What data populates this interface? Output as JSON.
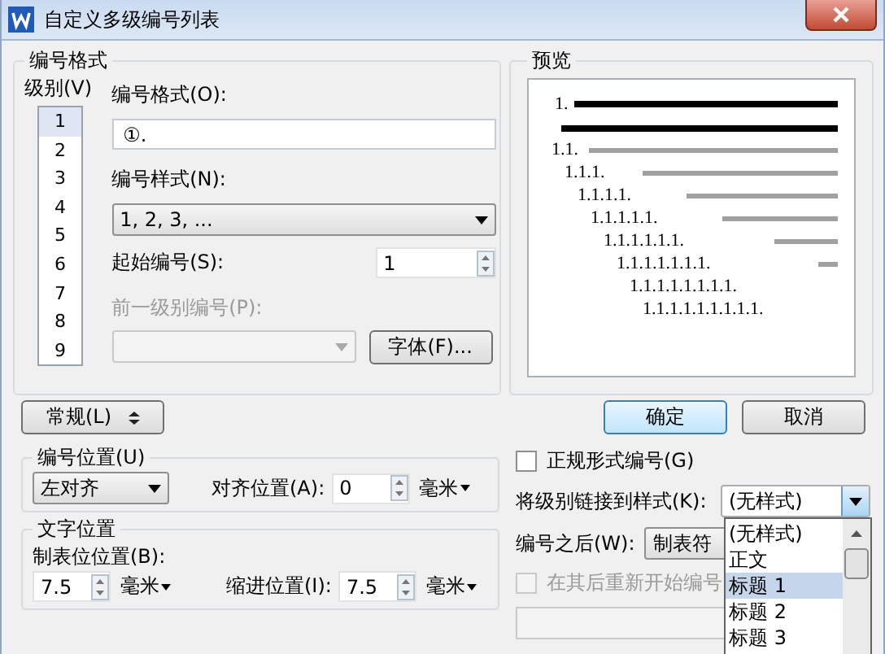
{
  "window": {
    "title": "自定义多级编号列表"
  },
  "number_format": {
    "legend": "编号格式",
    "level_label": "级别(V)",
    "levels": [
      {
        "label": "1",
        "selected": true
      },
      {
        "label": "2",
        "selected": false
      },
      {
        "label": "3",
        "selected": false
      },
      {
        "label": "4",
        "selected": false
      },
      {
        "label": "5",
        "selected": false
      },
      {
        "label": "6",
        "selected": false
      },
      {
        "label": "7",
        "selected": false
      },
      {
        "label": "8",
        "selected": false
      },
      {
        "label": "9",
        "selected": false
      }
    ],
    "format_label": "编号格式(O):",
    "format_value": "①.",
    "style_label": "编号样式(N):",
    "style_value": "1, 2, 3, ...",
    "start_label": "起始编号(S):",
    "start_value": "1",
    "prev_label": "前一级别编号(P):",
    "prev_disabled": true,
    "font_button": "字体(F)..."
  },
  "preview": {
    "legend": "预览",
    "lines": [
      "1.",
      "1.1.",
      "1.1.1.",
      "1.1.1.1.",
      "1.1.1.1.1.",
      "1.1.1.1.1.1.",
      "1.1.1.1.1.1.1.",
      "1.1.1.1.1.1.1.1.",
      "1.1.1.1.1.1.1.1.1."
    ]
  },
  "buttons": {
    "general": "常规(L)",
    "ok": "确定",
    "cancel": "取消"
  },
  "number_position": {
    "legend": "编号位置(U)",
    "align_value": "左对齐",
    "align_pos_label": "对齐位置(A):",
    "align_pos_value": "0",
    "unit": "毫米"
  },
  "text_position": {
    "legend": "文字位置",
    "tab_label": "制表位位置(B):",
    "tab_value": "7.5",
    "tab_unit": "毫米",
    "indent_label": "缩进位置(I):",
    "indent_value": "7.5",
    "indent_unit": "毫米"
  },
  "options": {
    "legal": {
      "label": "正规形式编号(G)",
      "checked": false
    },
    "link_label": "将级别链接到样式(K):",
    "link_value": "(无样式)",
    "after_label": "编号之后(W):",
    "after_value": "制表符",
    "restart": {
      "label": "在其后重新开始编号",
      "checked": false,
      "disabled": true
    }
  },
  "style_dropdown": {
    "items": [
      {
        "label": "(无样式)",
        "selected": false
      },
      {
        "label": "正文",
        "selected": false
      },
      {
        "label": "标题 1",
        "selected": true
      },
      {
        "label": "标题 2",
        "selected": false
      },
      {
        "label": "标题 3",
        "selected": false
      }
    ]
  }
}
